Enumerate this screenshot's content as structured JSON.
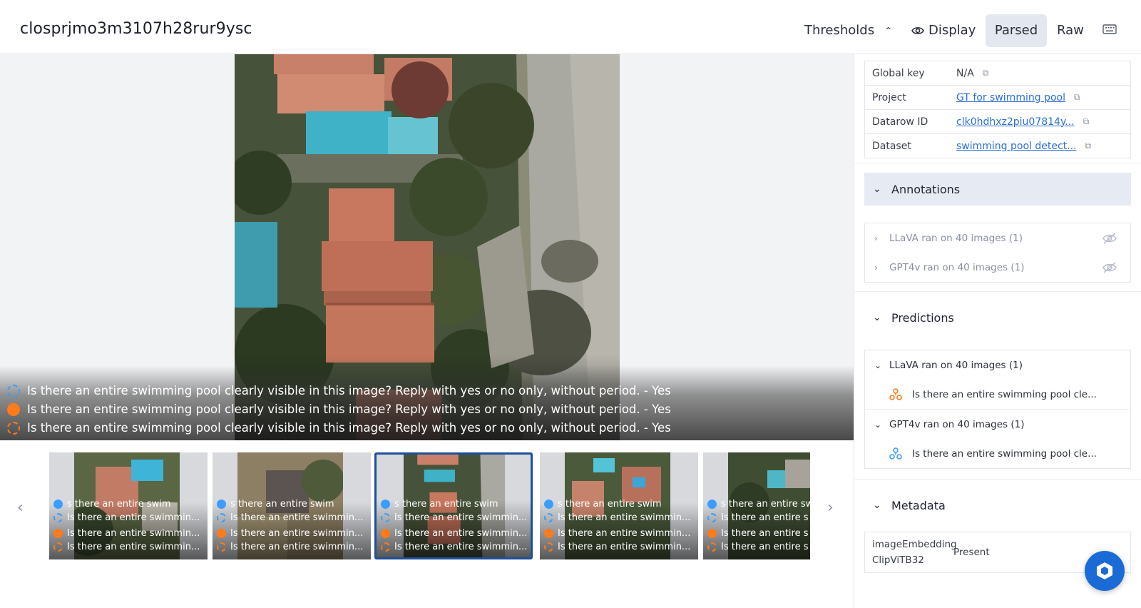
{
  "header": {
    "title": "closprjmo3m3107h28rur9ysc",
    "thresholds_label": "Thresholds",
    "display_label": "Display",
    "parsed_label": "Parsed",
    "raw_label": "Raw",
    "accent_color": "#1e4f9c"
  },
  "viewer": {
    "predictions": [
      {
        "marker": "blue-dashed-circle",
        "text": "Is there an entire swimming pool clearly visible in this image? Reply with yes or no only, without period. - Yes"
      },
      {
        "marker": "orange-filled-circle",
        "text": "Is there an entire swimming pool clearly visible in this image? Reply with yes or no only, without period. - Yes"
      },
      {
        "marker": "orange-dashed-circle",
        "text": "Is there an entire swimming pool clearly visible in this image? Reply with yes or no only, without period. - Yes"
      }
    ]
  },
  "thumbnails": {
    "items": [
      {
        "selected": false,
        "lines": [
          "s there an entire swim",
          "Is there an entire swimmin...",
          "Is there an entire swimmin...",
          "Is there an entire swimmin..."
        ]
      },
      {
        "selected": false,
        "lines": [
          "s there an entire swim",
          "Is there an entire swimmin...",
          "Is there an entire swimmin...",
          "Is there an entire swimmin..."
        ]
      },
      {
        "selected": true,
        "lines": [
          "s there an entire swim",
          "Is there an entire swimmin...",
          "Is there an entire swimmin...",
          "Is there an entire swimmin..."
        ]
      },
      {
        "selected": false,
        "lines": [
          "s there an entire swim",
          "Is there an entire swimmin...",
          "Is there an entire swimmin...",
          "Is there an entire swimmin..."
        ]
      },
      {
        "selected": false,
        "lines": [
          "s there an entire sw",
          "Is there an entire s",
          "Is there an entire s",
          "Is there an entire s"
        ]
      }
    ]
  },
  "sidebar": {
    "info": [
      {
        "key": "Global key",
        "value": "N/A",
        "link": false
      },
      {
        "key": "Project",
        "value": "GT for swimming pool",
        "link": true
      },
      {
        "key": "Datarow ID",
        "value": "clk0hdhxz2piu07814y...",
        "link": true
      },
      {
        "key": "Dataset",
        "value": "swimming pool detect...",
        "link": true
      }
    ],
    "annotations": {
      "title": "Annotations",
      "items": [
        "LLaVA ran on 40 images (1)",
        "GPT4v ran on 40 images (1)"
      ]
    },
    "predictions": {
      "title": "Predictions",
      "groups": [
        {
          "name": "LLaVA ran on 40 images (1)",
          "item": "Is there an entire swimming pool cle...",
          "icon_color": "#ff7a1a"
        },
        {
          "name": "GPT4v ran on 40 images (1)",
          "item": "Is there an entire swimming pool cle...",
          "icon_color": "#3b9cff"
        }
      ]
    },
    "metadata": {
      "title": "Metadata",
      "rows": [
        {
          "key_line1": "imageEmbedding",
          "key_line2": "ClipViTB32",
          "value": "Present"
        }
      ]
    }
  }
}
